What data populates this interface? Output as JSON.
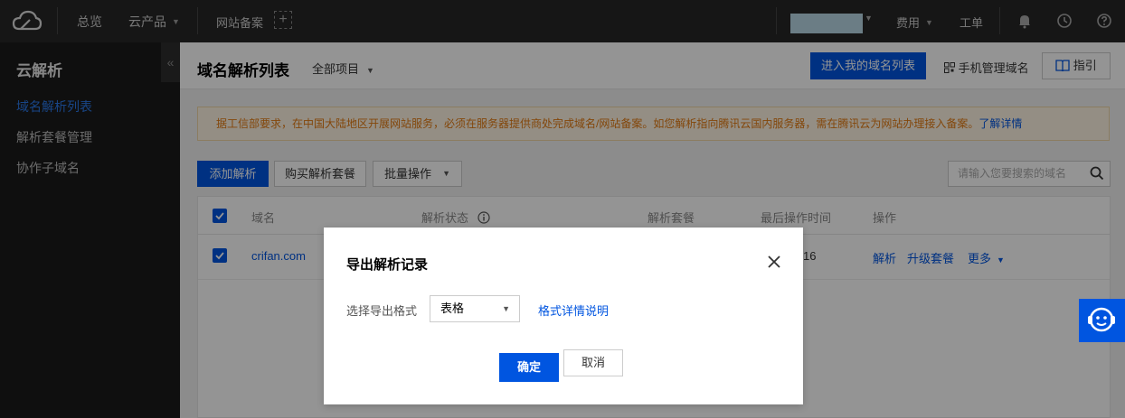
{
  "topbar": {
    "overview": "总览",
    "products": "云产品",
    "icp": "网站备案",
    "plus": "+",
    "billing": "费用",
    "ticket": "工单"
  },
  "sidebar": {
    "title": "云解析",
    "collapse": "«",
    "items": [
      {
        "label": "域名解析列表"
      },
      {
        "label": "解析套餐管理"
      },
      {
        "label": "协作子域名"
      }
    ]
  },
  "header": {
    "title": "域名解析列表",
    "project": "全部项目",
    "enter_btn": "进入我的域名列表",
    "mobile": "手机管理域名",
    "guide": "指引"
  },
  "notice": {
    "text": "据工信部要求，在中国大陆地区开展网站服务，必须在服务器提供商处完成域名/网站备案。如您解析指向腾讯云国内服务器，需在腾讯云为网站办理接入备案。",
    "link": "了解详情"
  },
  "toolbar": {
    "add": "添加解析",
    "buy": "购买解析套餐",
    "batch": "批量操作",
    "search_placeholder": "请输入您要搜索的域名"
  },
  "table": {
    "headers": [
      "域名",
      "解析状态",
      "解析套餐",
      "最后操作时间",
      "操作"
    ],
    "rows": [
      {
        "domain": "crifan.com",
        "time_fragment": "16",
        "actions": [
          "解析",
          "升级套餐",
          "更多"
        ]
      }
    ]
  },
  "dialog": {
    "title": "导出解析记录",
    "label": "选择导出格式",
    "format_value": "表格",
    "help_link": "格式详情说明",
    "ok": "确定",
    "cancel": "取消"
  }
}
